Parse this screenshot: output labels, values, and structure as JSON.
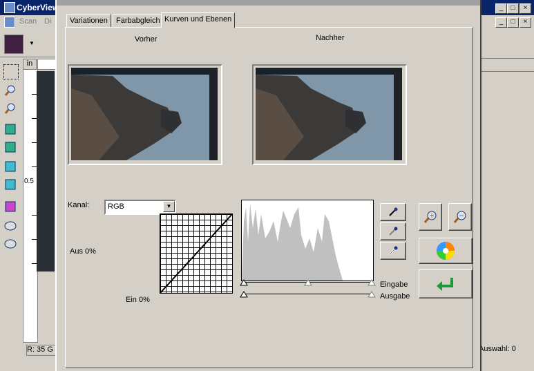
{
  "app": {
    "title": "CyberView",
    "menu": [
      "Scan",
      "Di"
    ],
    "window_controls": [
      "_",
      "□",
      "×"
    ],
    "ruler_unit": "in",
    "ruler_mid_label": "0.5",
    "status_left": "R: 35  G",
    "status_right": "Auswahl: 0"
  },
  "dialog": {
    "tabs": [
      {
        "label": "Variationen",
        "active": false
      },
      {
        "label": "Farbabgleich",
        "active": false
      },
      {
        "label": "Kurven und Ebenen",
        "active": true
      }
    ],
    "before_label": "Vorher",
    "after_label": "Nachher",
    "channel_label": "Kanal:",
    "channel_value": "RGB",
    "output_label": "Aus 0%",
    "input_label": "Ein  0%",
    "input_slider_label": "Eingabe",
    "output_slider_label": "Ausgabe",
    "icons": {
      "eyedropper_black": "eyedropper-black-icon",
      "eyedropper_gray": "eyedropper-gray-icon",
      "eyedropper_white": "eyedropper-white-icon",
      "zoom_in": "zoom-in-icon",
      "zoom_out": "zoom-out-icon",
      "color_wheel": "color-wheel-icon",
      "reset": "reset-arrow-icon"
    }
  }
}
